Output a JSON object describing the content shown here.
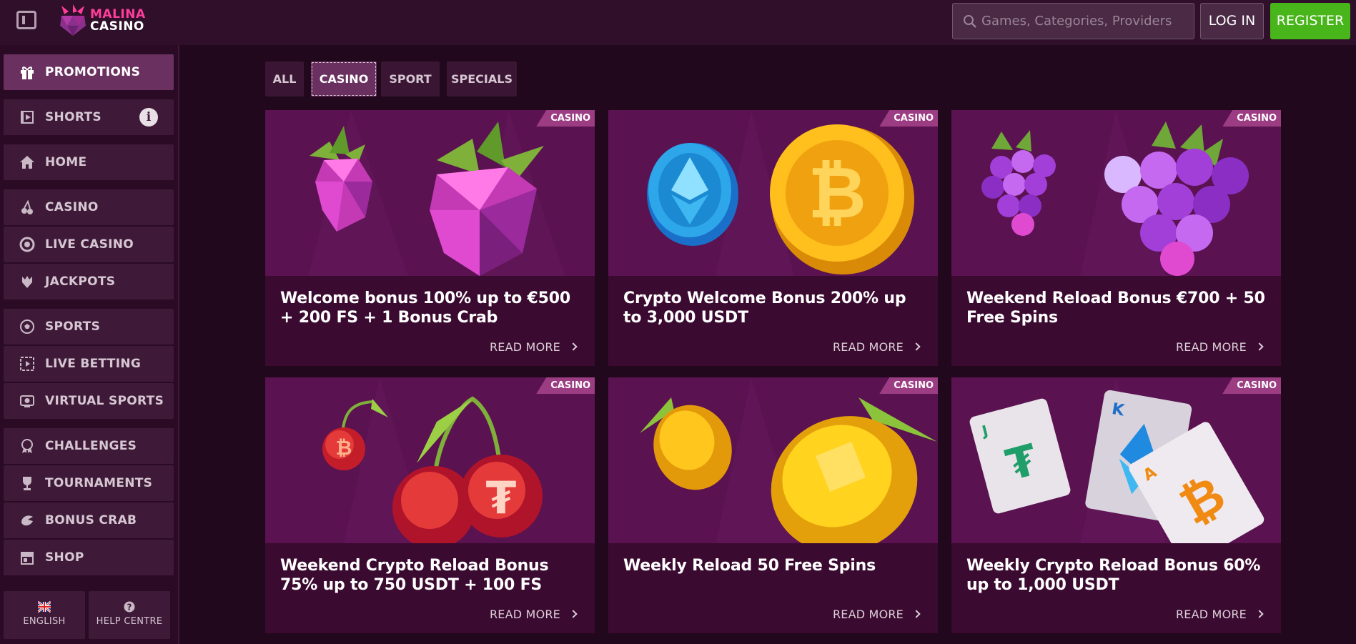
{
  "header": {
    "logo": {
      "line1": "MALINA",
      "line2": "CASINO"
    },
    "search_placeholder": "Games, Categories, Providers",
    "login_label": "LOG IN",
    "register_label": "REGISTER"
  },
  "sidebar": {
    "items": [
      {
        "label": "PROMOTIONS",
        "icon": "gift-icon",
        "active": true
      },
      {
        "label": "SHORTS",
        "icon": "film-icon"
      },
      {
        "label": "HOME",
        "icon": "home-icon"
      },
      {
        "label": "CASINO",
        "icon": "cherries-icon"
      },
      {
        "label": "LIVE CASINO",
        "icon": "chip-icon"
      },
      {
        "label": "JACKPOTS",
        "icon": "raspberry-icon"
      },
      {
        "label": "SPORTS",
        "icon": "soccer-ball-icon"
      },
      {
        "label": "LIVE BETTING",
        "icon": "live-betting-icon"
      },
      {
        "label": "VIRTUAL SPORTS",
        "icon": "virtual-sports-icon"
      },
      {
        "label": "CHALLENGES",
        "icon": "medal-icon"
      },
      {
        "label": "TOURNAMENTS",
        "icon": "trophy-icon"
      },
      {
        "label": "BONUS CRAB",
        "icon": "crab-claw-icon"
      },
      {
        "label": "SHOP",
        "icon": "shop-icon"
      }
    ],
    "language_label": "ENGLISH",
    "help_label": "HELP CENTRE"
  },
  "tabs": [
    {
      "label": "ALL"
    },
    {
      "label": "CASINO",
      "active": true
    },
    {
      "label": "SPORT"
    },
    {
      "label": "SPECIALS"
    }
  ],
  "promotions": [
    {
      "badge": "CASINO",
      "title": "Welcome bonus 100% up to €500 + 200 FS + 1 Bonus Crab",
      "read_more": "READ MORE",
      "art": "raspberries"
    },
    {
      "badge": "CASINO",
      "title": "Crypto Welcome Bonus 200% up to 3,000 USDT",
      "read_more": "READ MORE",
      "art": "crypto-coins"
    },
    {
      "badge": "CASINO",
      "title": "Weekend Reload Bonus €700 + 50 Free Spins",
      "read_more": "READ MORE",
      "art": "grapes"
    },
    {
      "badge": "CASINO",
      "title": "Weekend Crypto Reload Bonus 75% up to 750 USDT + 100 FS",
      "read_more": "READ MORE",
      "art": "cherries"
    },
    {
      "badge": "CASINO",
      "title": "Weekly Reload 50 Free Spins",
      "read_more": "READ MORE",
      "art": "lemons"
    },
    {
      "badge": "CASINO",
      "title": "Weekly Crypto Reload Bonus 60% up to 1,000 USDT",
      "read_more": "READ MORE",
      "art": "playing-cards"
    }
  ],
  "colors": {
    "background": "#22081c",
    "topbar": "#2f0f2a",
    "sidebar_item": "#3e1a38",
    "active": "#6a3160",
    "register": "#48b51a",
    "badge": "#9c3d84",
    "logo_accent": "#ff3d9a"
  }
}
